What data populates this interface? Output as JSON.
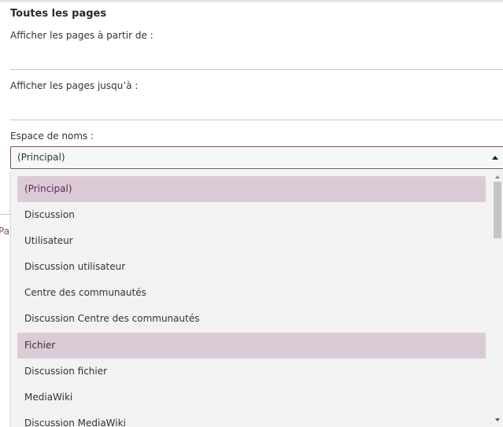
{
  "form": {
    "title": "Toutes les pages",
    "from_label": "Afficher les pages à partir de :",
    "from_value": "",
    "to_label": "Afficher les pages jusqu’à :",
    "to_value": "",
    "namespace_label": "Espace de noms :",
    "namespace_value": "(Principal)",
    "arrow_icon": "caret-up-icon"
  },
  "background": {
    "partial_text": "Pa"
  },
  "dropdown": {
    "options": [
      {
        "label": "(Principal)",
        "highlighted": true,
        "selected": true
      },
      {
        "label": "Discussion",
        "highlighted": false,
        "selected": false
      },
      {
        "label": "Utilisateur",
        "highlighted": false,
        "selected": false
      },
      {
        "label": "Discussion utilisateur",
        "highlighted": false,
        "selected": false
      },
      {
        "label": "Centre des communautés",
        "highlighted": false,
        "selected": false
      },
      {
        "label": "Discussion Centre des communautés",
        "highlighted": false,
        "selected": false
      },
      {
        "label": "Fichier",
        "highlighted": true,
        "selected": false
      },
      {
        "label": "Discussion fichier",
        "highlighted": false,
        "selected": false
      },
      {
        "label": "MediaWiki",
        "highlighted": false,
        "selected": false
      },
      {
        "label": "Discussion MediaWiki",
        "highlighted": false,
        "selected": false
      }
    ],
    "highlight_color": "#dccbd6",
    "accent_color": "#7c4d76"
  }
}
